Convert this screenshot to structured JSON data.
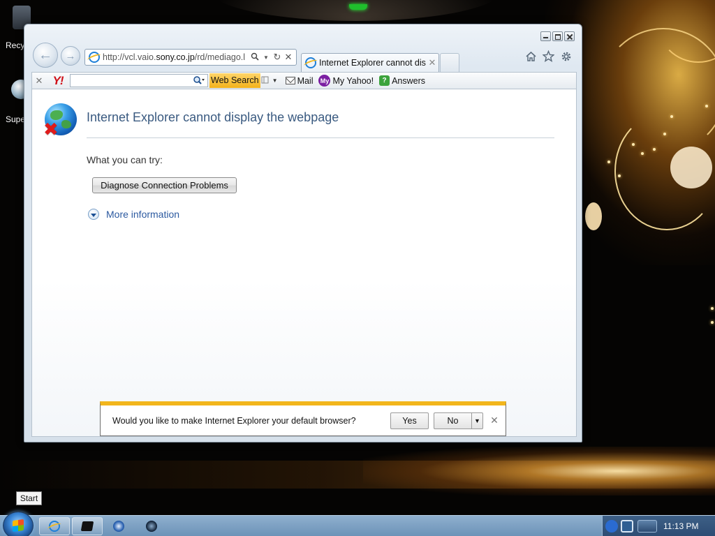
{
  "desktop": {
    "icons": [
      {
        "label": "Recy"
      },
      {
        "label": "Supe"
      }
    ]
  },
  "browser": {
    "address": {
      "prefix": "http://vcl.vaio.",
      "domain": "sony.co.jp",
      "suffix": "/rd/mediago.l"
    },
    "tab": {
      "title": "Internet Explorer cannot dis..."
    },
    "toolbar": {
      "web_search": "Web Search",
      "mail": "Mail",
      "my_yahoo": "My Yahoo!",
      "my_badge": "My",
      "answers": "Answers",
      "yahoo_logo": "Y!"
    },
    "page": {
      "title": "Internet Explorer cannot display the webpage",
      "try_label": "What you can try:",
      "diagnose_button": "Diagnose Connection Problems",
      "more_info": "More information"
    },
    "notification": {
      "message": "Would you like to make Internet Explorer your default browser?",
      "yes": "Yes",
      "no": "No"
    }
  },
  "taskbar": {
    "start_tooltip": "Start",
    "clock": "11:13 PM"
  },
  "colors": {
    "notification_accent": "#f2b61c",
    "page_title": "#3a5a80",
    "link": "#2c5aa0",
    "yahoo_red": "#d01018"
  },
  "icons": [
    "back-arrow-icon",
    "forward-arrow-icon",
    "ie-icon",
    "search-icon",
    "refresh-icon",
    "stop-icon",
    "home-icon",
    "favorites-star-icon",
    "gear-icon",
    "globe-error-icon",
    "chevron-down-icon",
    "mail-icon",
    "my-yahoo-icon",
    "answers-icon",
    "windows-start-orb"
  ]
}
